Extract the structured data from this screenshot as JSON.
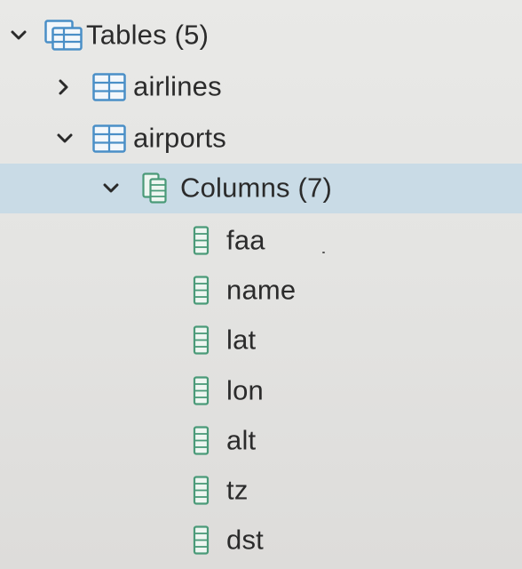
{
  "tree": {
    "tables": {
      "label": "Tables (5)",
      "icon": "tables-folder-icon",
      "expanded": true,
      "children": [
        {
          "label": "airlines",
          "icon": "table-icon",
          "expanded": false
        },
        {
          "label": "airports",
          "icon": "table-icon",
          "expanded": true,
          "columns": {
            "label": "Columns (7)",
            "icon": "columns-folder-icon",
            "expanded": true,
            "selected": true,
            "items": [
              {
                "label": "faa",
                "icon": "column-icon"
              },
              {
                "label": "name",
                "icon": "column-icon"
              },
              {
                "label": "lat",
                "icon": "column-icon"
              },
              {
                "label": "lon",
                "icon": "column-icon"
              },
              {
                "label": "alt",
                "icon": "column-icon"
              },
              {
                "label": "tz",
                "icon": "column-icon"
              },
              {
                "label": "dst",
                "icon": "column-icon"
              }
            ]
          }
        }
      ]
    }
  },
  "colors": {
    "selection": "#c9dbe6",
    "table_icon_blue": "#4a8fc7",
    "column_icon_green": "#4a9a78",
    "text": "#2b2b2b"
  }
}
